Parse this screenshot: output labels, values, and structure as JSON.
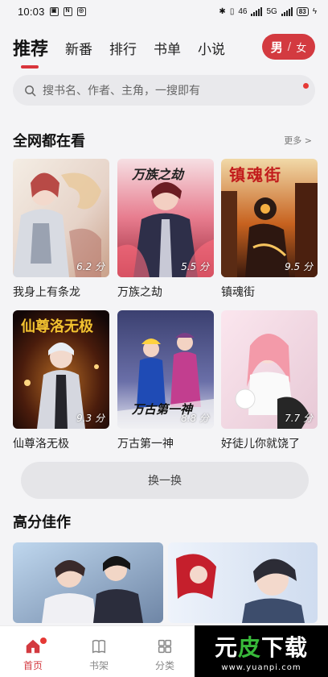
{
  "status_bar": {
    "time": "10:03",
    "network": "46",
    "network2": "5G",
    "battery": "83"
  },
  "nav": {
    "tabs": [
      "推荐",
      "新番",
      "排行",
      "书单",
      "小说"
    ],
    "gender": {
      "male": "男",
      "separator": "/",
      "female": "女"
    }
  },
  "search": {
    "placeholder": "搜书名、作者、主角，一搜即有"
  },
  "section_hot": {
    "title": "全网都在看",
    "more": "更多 >",
    "items": [
      {
        "title": "我身上有条龙",
        "score": "6.2 分"
      },
      {
        "title": "万族之劫",
        "score": "5.5 分"
      },
      {
        "title": "镇魂街",
        "score": "9.5 分"
      },
      {
        "title": "仙尊洛无极",
        "score": "9.3 分"
      },
      {
        "title": "万古第一神",
        "score": "8.8 分"
      },
      {
        "title": "好徒儿你就饶了",
        "score": "7.7 分"
      }
    ],
    "cover_texts": {
      "cover2": "万族之劫",
      "cover3": "镇魂街",
      "cover4": "仙尊洛无极",
      "cover5": "万古第一神"
    },
    "refresh": "换一换"
  },
  "section_top": {
    "title": "高分佳作"
  },
  "bottom_nav": [
    {
      "label": "首页",
      "icon": "home-icon"
    },
    {
      "label": "书架",
      "icon": "bookshelf-icon"
    },
    {
      "label": "分类",
      "icon": "category-icon"
    }
  ],
  "watermark": {
    "main_a": "元",
    "main_b": "皮",
    "main_c": "下载",
    "url": "www.yuanpi.com"
  },
  "colors": {
    "accent": "#d33a40",
    "background": "#f4f4f6"
  }
}
